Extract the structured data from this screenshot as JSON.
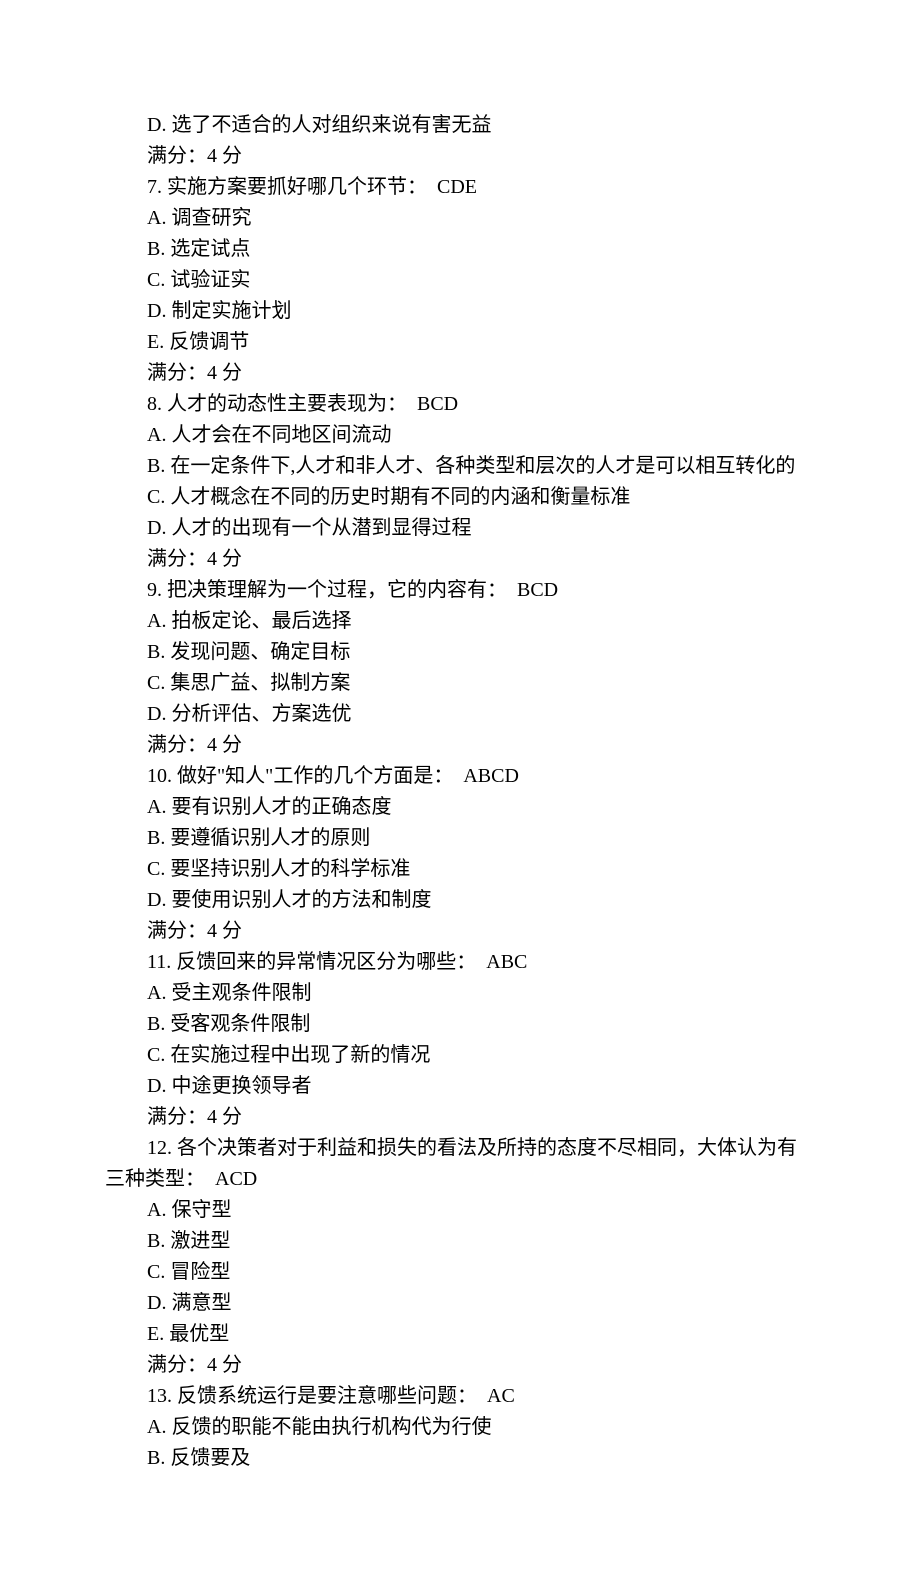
{
  "lines": [
    {
      "text": "D. 选了不适合的人对组织来说有害无益",
      "indent": 1
    },
    {
      "text": "满分：4 分",
      "indent": 1
    },
    {
      "text": "7. 实施方案要抓好哪几个环节：  CDE",
      "indent": 1
    },
    {
      "text": "A. 调查研究",
      "indent": 1
    },
    {
      "text": "B. 选定试点",
      "indent": 1
    },
    {
      "text": "C. 试验证实",
      "indent": 1
    },
    {
      "text": "D. 制定实施计划",
      "indent": 1
    },
    {
      "text": "E. 反馈调节",
      "indent": 1
    },
    {
      "text": "满分：4 分",
      "indent": 1
    },
    {
      "text": "8. 人才的动态性主要表现为：  BCD",
      "indent": 1
    },
    {
      "text": "A. 人才会在不同地区间流动",
      "indent": 1
    },
    {
      "text": "B. 在一定条件下,人才和非人才、各种类型和层次的人才是可以相互转化的",
      "indent": 1
    },
    {
      "text": "C. 人才概念在不同的历史时期有不同的内涵和衡量标准",
      "indent": 1
    },
    {
      "text": "D. 人才的出现有一个从潜到显得过程",
      "indent": 1
    },
    {
      "text": "满分：4 分",
      "indent": 1
    },
    {
      "text": "9. 把决策理解为一个过程，它的内容有：  BCD",
      "indent": 1
    },
    {
      "text": "A. 拍板定论、最后选择",
      "indent": 1
    },
    {
      "text": "B. 发现问题、确定目标",
      "indent": 1
    },
    {
      "text": "C. 集思广益、拟制方案",
      "indent": 1
    },
    {
      "text": "D. 分析评估、方案选优",
      "indent": 1
    },
    {
      "text": "满分：4 分",
      "indent": 1
    },
    {
      "text": "10. 做好\"知人\"工作的几个方面是：  ABCD",
      "indent": 1
    },
    {
      "text": "A. 要有识别人才的正确态度",
      "indent": 1
    },
    {
      "text": "B. 要遵循识别人才的原则",
      "indent": 1
    },
    {
      "text": "C. 要坚持识别人才的科学标准",
      "indent": 1
    },
    {
      "text": "D. 要使用识别人才的方法和制度",
      "indent": 1
    },
    {
      "text": "满分：4 分",
      "indent": 1
    },
    {
      "text": "11. 反馈回来的异常情况区分为哪些：  ABC",
      "indent": 1
    },
    {
      "text": "A. 受主观条件限制",
      "indent": 1
    },
    {
      "text": "B. 受客观条件限制",
      "indent": 1
    },
    {
      "text": "C. 在实施过程中出现了新的情况",
      "indent": 1
    },
    {
      "text": "D. 中途更换领导者",
      "indent": 1
    },
    {
      "text": "满分：4 分",
      "indent": 1
    },
    {
      "text": "12. 各个决策者对于利益和损失的看法及所持的态度不尽相同，大体认为有",
      "indent": 1
    },
    {
      "text": "三种类型：  ACD",
      "indent": 0
    },
    {
      "text": "A. 保守型",
      "indent": 1
    },
    {
      "text": "B. 激进型",
      "indent": 1
    },
    {
      "text": "C. 冒险型",
      "indent": 1
    },
    {
      "text": "D. 满意型",
      "indent": 1
    },
    {
      "text": "E. 最优型",
      "indent": 1
    },
    {
      "text": "满分：4 分",
      "indent": 1
    },
    {
      "text": "13. 反馈系统运行是要注意哪些问题：  AC",
      "indent": 1
    },
    {
      "text": "A. 反馈的职能不能由执行机构代为行使",
      "indent": 1
    },
    {
      "text": "B. 反馈要及",
      "indent": 1
    }
  ]
}
